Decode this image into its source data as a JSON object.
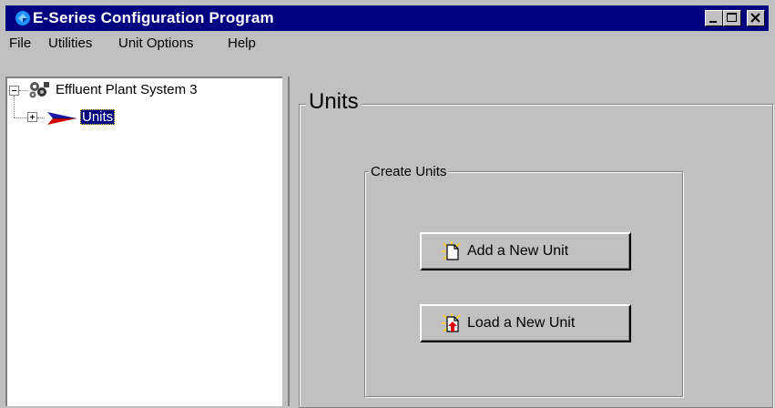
{
  "window": {
    "title": "E-Series Configuration Program",
    "icon": "app-logo-icon",
    "controls": [
      "minimize-icon",
      "maximize-icon",
      "close-icon"
    ]
  },
  "menu": {
    "items": [
      "File",
      "Utilities",
      "Unit Options",
      "Help"
    ]
  },
  "tree": {
    "root": {
      "label": "Effluent Plant System 3",
      "icon": "gears-icon",
      "expanded": true
    },
    "child": {
      "label": "Units",
      "icon": "arrow-icon",
      "expanded": false,
      "selected": true
    }
  },
  "panel": {
    "title": "Units",
    "group": {
      "title": "Create Units",
      "buttons": [
        {
          "label": "Add a New Unit",
          "icon": "new-document-icon"
        },
        {
          "label": "Load a New Unit",
          "icon": "load-document-icon"
        }
      ]
    }
  },
  "colors": {
    "titlebar": "#000080",
    "face": "#c0c0c0",
    "selection": "#000080"
  }
}
